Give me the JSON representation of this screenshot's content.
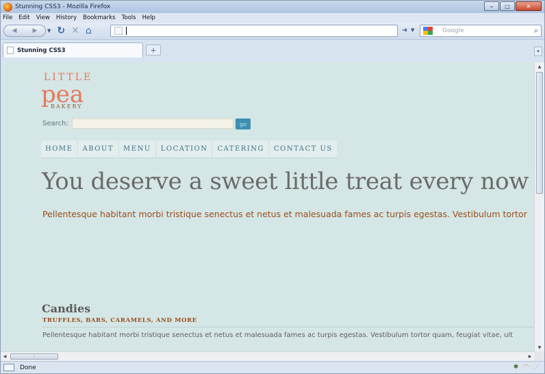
{
  "window": {
    "title": "Stunning CSS3 - Mozilla Firefox"
  },
  "menubar": {
    "items": [
      "File",
      "Edit",
      "View",
      "History",
      "Bookmarks",
      "Tools",
      "Help"
    ]
  },
  "navbar": {
    "url": "",
    "search_placeholder": "Google"
  },
  "tabs": [
    {
      "label": "Stunning CSS3"
    }
  ],
  "page": {
    "logo": {
      "line1": "LITTLE",
      "line2": "pea",
      "line3": "BAKERY"
    },
    "search": {
      "label": "Search:",
      "button": "go"
    },
    "nav": [
      "HOME",
      "ABOUT",
      "MENU",
      "LOCATION",
      "CATERING",
      "CONTACT US"
    ],
    "headline": "You deserve a sweet little treat every now and",
    "lead": "Pellentesque habitant morbi tristique senectus et netus et malesuada fames ac turpis egestas. Vestibulum tortor",
    "section": {
      "title": "Candies",
      "subtitle": "TRUFFLES, BARS, CARAMELS, AND MORE",
      "body": "Pellentesque habitant morbi tristique senectus et netus et malesuada fames ac turpis egestas. Vestibulum tortor quam, feugiat vitae, ult"
    }
  },
  "status": {
    "text": "Done"
  },
  "colors": {
    "accent": "#e7775c",
    "rust": "#9b4d1c",
    "nav_text": "#3f6f85",
    "page_bg": "#d4e6e5",
    "go_button": "#3c8fb0"
  }
}
